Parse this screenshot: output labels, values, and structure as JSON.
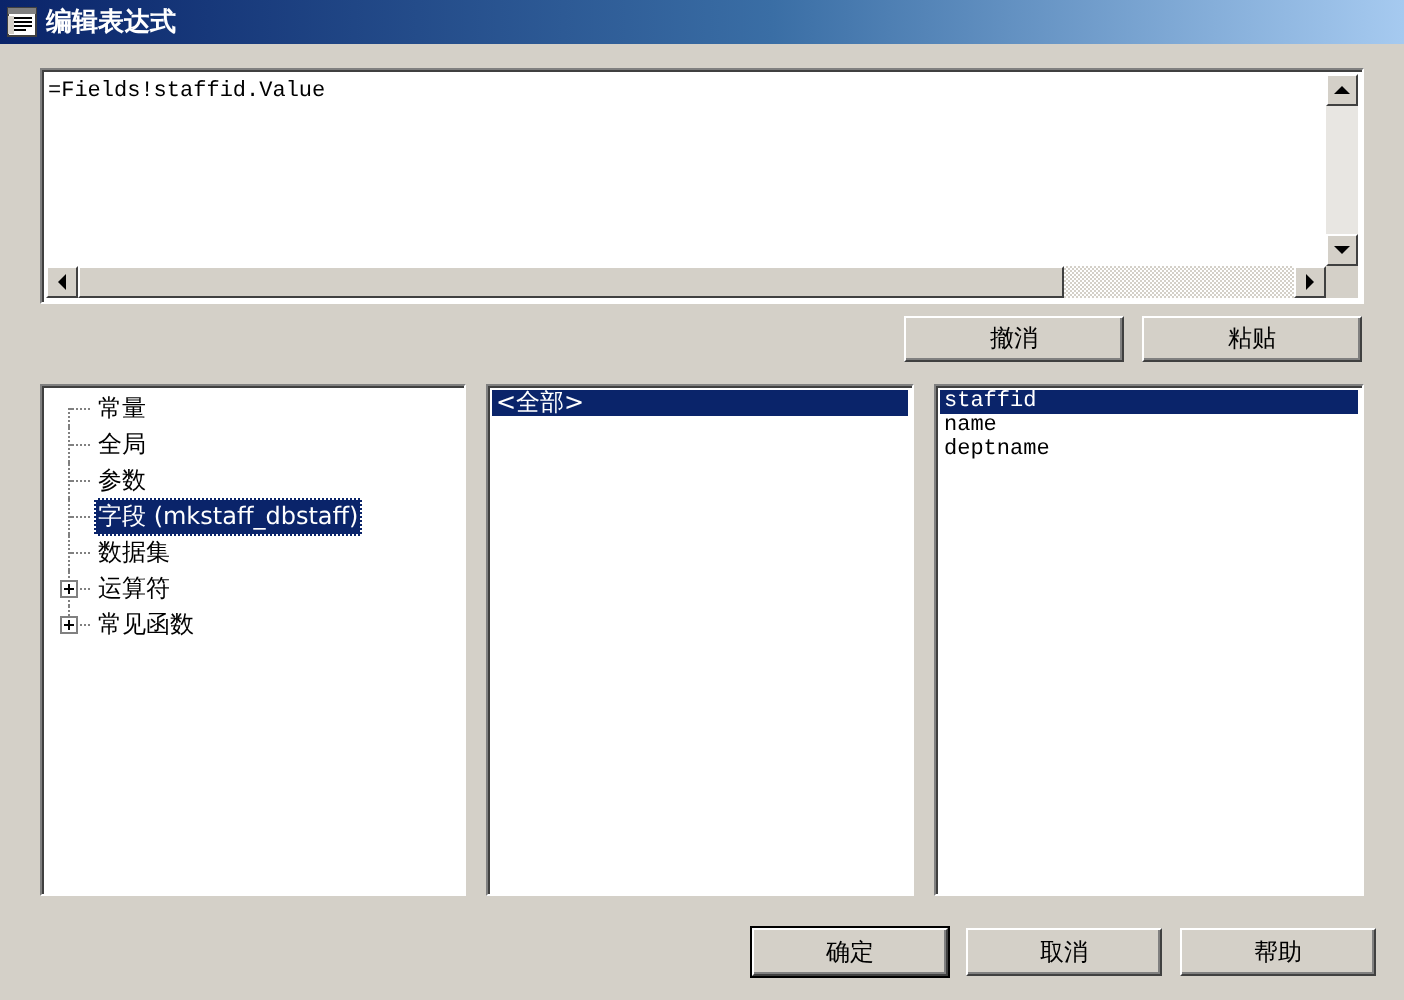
{
  "window": {
    "title": "编辑表达式"
  },
  "expression": {
    "value": "=Fields!staffid.Value"
  },
  "edit_buttons": [
    {
      "label": "撤消"
    },
    {
      "label": "粘贴"
    }
  ],
  "tree": {
    "items": [
      {
        "label": "常量",
        "kind": "leaf",
        "selected": false
      },
      {
        "label": "全局",
        "kind": "leaf",
        "selected": false
      },
      {
        "label": "参数",
        "kind": "leaf",
        "selected": false
      },
      {
        "label": "字段 (mkstaff_dbstaff)",
        "kind": "leaf",
        "selected": true
      },
      {
        "label": "数据集",
        "kind": "leaf",
        "selected": false
      },
      {
        "label": "运算符",
        "kind": "group",
        "expanded": false,
        "selected": false
      },
      {
        "label": "常见函数",
        "kind": "group",
        "expanded": false,
        "selected": false
      }
    ]
  },
  "categories": {
    "items": [
      {
        "label": "<全部>",
        "selected": true
      }
    ]
  },
  "fields": {
    "items": [
      {
        "label": "staffid",
        "selected": true
      },
      {
        "label": "name",
        "selected": false
      },
      {
        "label": "deptname",
        "selected": false
      }
    ]
  },
  "buttons": [
    {
      "label": "确定",
      "default": true
    },
    {
      "label": "取消",
      "default": false
    },
    {
      "label": "帮助",
      "default": false
    }
  ]
}
